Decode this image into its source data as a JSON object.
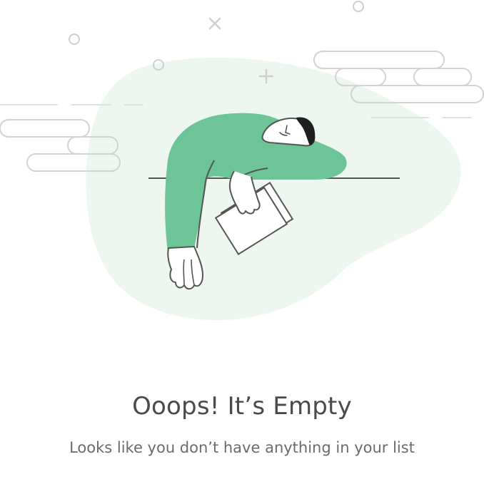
{
  "empty_state": {
    "title": "Ooops! It’s Empty",
    "message": "Looks like you don’t have anything in your list"
  },
  "colors": {
    "blob": "#eef6f0",
    "figure": "#6cc497",
    "line": "#555555",
    "light_line": "#d6d6d6",
    "hair": "#1f1f1f",
    "text_title": "#4a4a4a",
    "text_body": "#6b6b6b"
  },
  "icons": {
    "illustration": "tired-person-illustration",
    "decor": [
      "cloud-icon",
      "circle-icon",
      "cross-icon",
      "plus-icon"
    ]
  }
}
